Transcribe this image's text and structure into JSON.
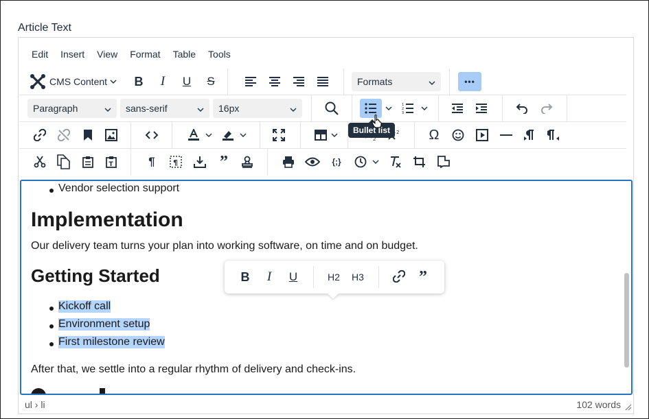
{
  "field_label": "Article Text",
  "menubar": [
    "Edit",
    "Insert",
    "View",
    "Format",
    "Table",
    "Tools"
  ],
  "toolbar": {
    "cms_content": "CMS Content",
    "formats": "Formats",
    "block_format": "Paragraph",
    "font_family": "sans-serif",
    "font_size": "16px",
    "more_label": "•••"
  },
  "tooltip": "Bullet list",
  "content": {
    "prev_bullet": "Vendor selection support",
    "h1": "Implementation",
    "para1": "Our delivery team turns your plan into working software, on time and on budget.",
    "h2": "Getting Started",
    "bullets": [
      "Kickoff call",
      "Environment setup",
      "First milestone review"
    ],
    "para2": "After that, we settle into a regular rhythm of delivery and check-ins."
  },
  "floating_toolbar": {
    "h2": "H2",
    "h3": "H3"
  },
  "statusbar": {
    "path": "ul › li",
    "words": "102 words"
  },
  "colors": {
    "accent": "#2672c5",
    "active_button": "#a6ccf7",
    "selection": "#b4d5fe",
    "tooltip_bg": "#222f3e"
  }
}
